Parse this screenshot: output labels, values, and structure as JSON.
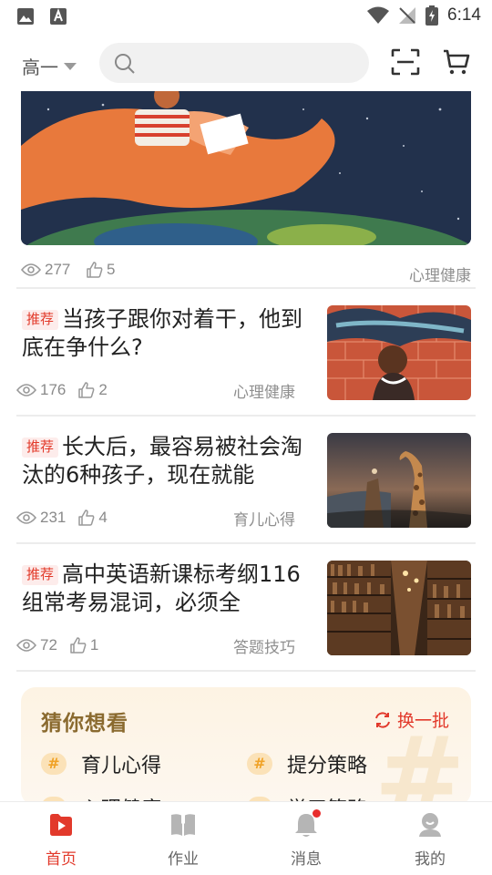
{
  "status_bar": {
    "time": "6:14"
  },
  "header": {
    "grade": "高一",
    "search_placeholder": ""
  },
  "top_item": {
    "views": "277",
    "likes": "5",
    "category": "心理健康"
  },
  "articles": [
    {
      "tag": "推荐",
      "title": "当孩子跟你对着干，他到底在争什么?",
      "views": "176",
      "likes": "2",
      "category": "心理健康"
    },
    {
      "tag": "推荐",
      "title": "长大后，最容易被社会淘汰的6种孩子，现在就能",
      "views": "231",
      "likes": "4",
      "category": "育儿心得"
    },
    {
      "tag": "推荐",
      "title": "高中英语新课标考纲116组常考易混词，必须全",
      "views": "72",
      "likes": "1",
      "category": "答题技巧"
    }
  ],
  "guess": {
    "title": "猜你想看",
    "refresh_label": "换一批",
    "chips": [
      "育儿心得",
      "提分策略",
      "心理健康",
      "学习策略"
    ]
  },
  "bottom_nav": [
    {
      "label": "首页",
      "active": true
    },
    {
      "label": "作业",
      "active": false
    },
    {
      "label": "消息",
      "active": false
    },
    {
      "label": "我的",
      "active": false
    }
  ],
  "colors": {
    "accent": "#e2392b",
    "tag_bg": "#fdeceb",
    "guess_title": "#8a6a2f"
  }
}
